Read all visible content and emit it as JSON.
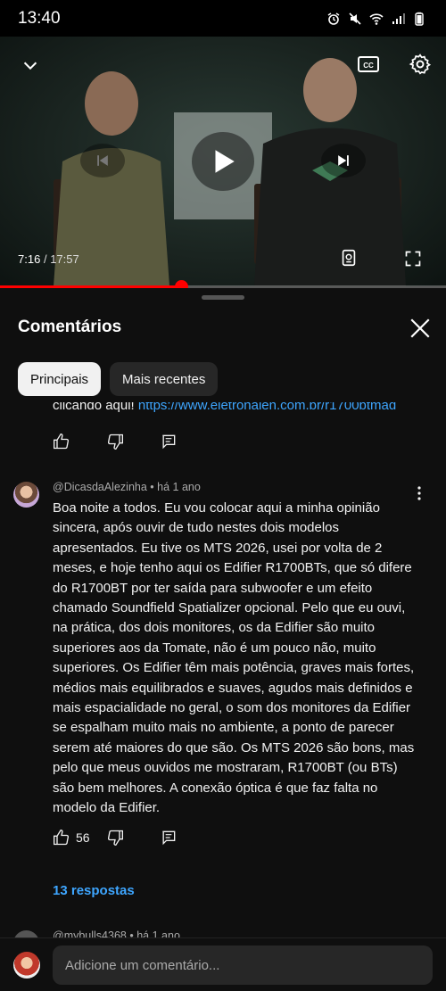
{
  "status_bar": {
    "time": "13:40",
    "icons": [
      "alarm-icon",
      "mute-icon",
      "wifi-icon",
      "signal-icon",
      "battery-icon"
    ]
  },
  "player": {
    "current_time": "7:16",
    "separator": "/",
    "duration": "17:57",
    "progress_fraction": 0.405,
    "icons": [
      "chevron-down-icon",
      "closed-captions-icon",
      "gear-icon",
      "skip-previous-icon",
      "play-icon",
      "skip-next-icon",
      "voice-icon",
      "fullscreen-icon"
    ]
  },
  "colors": {
    "accent_red": "#ff0000",
    "link_blue": "#3ea6ff",
    "background": "#0f0f0f",
    "chip_bg": "#272727"
  },
  "comments_sheet": {
    "title": "Comentários",
    "chips": [
      {
        "label": "Principais",
        "selected": true
      },
      {
        "label": "Mais recentes",
        "selected": false
      }
    ],
    "partial_comment": {
      "text": "clicando aqui! ",
      "link": "https://www.eletronalen.com.br/r1700btmad"
    },
    "comment": {
      "author": "@DicasdaAlezinha",
      "dot": "•",
      "age": "há 1 ano",
      "text": "Boa noite a todos. Eu vou colocar aqui a minha opinião sincera, após ouvir de tudo nestes dois modelos apresentados. Eu tive os MTS 2026, usei por volta de 2 meses, e hoje tenho aqui os Edifier R1700BTs, que só difere do R1700BT por ter saída para subwoofer e um efeito chamado Soundfield Spatializer opcional. Pelo que eu ouvi, na prática, dos dois monitores, os da Edifier são muito superiores aos da Tomate, não é um pouco não, muito superiores. Os Edifier têm mais potência, graves mais fortes, médios mais equilibrados e suaves, agudos mais definidos e mais espacialidade no geral, o som dos monitores da Edifier se espalham muito mais no ambiente, a ponto de parecer serem até maiores do que são. Os MTS 2026 são bons, mas pelo que meus ouvidos me mostraram, R1700BT (ou BTs) são bem melhores. A conexão óptica é que faz falta no modelo da Edifier.",
      "likes": "56",
      "replies_label": "13 respostas"
    },
    "next_comment": {
      "author": "@mybulls4368",
      "dot": "•",
      "age": "há 1 ano"
    },
    "composer": {
      "placeholder": "Adicione um comentário..."
    }
  }
}
